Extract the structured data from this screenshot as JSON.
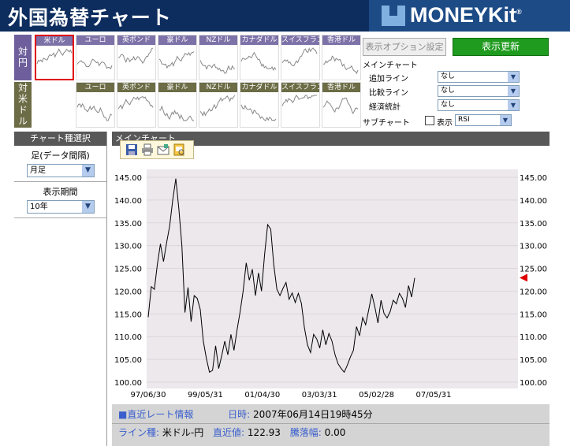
{
  "header": {
    "title": "外国為替チャート",
    "logo_text": "MONEYKit",
    "logo_registered": "®"
  },
  "thumbnails": {
    "row_jpy_label": "対円",
    "row_usd_label": "対米ドル",
    "jpy": [
      "米ドル",
      "ユーロ",
      "英ポンド",
      "豪ドル",
      "NZドル",
      "カナダドル",
      "スイスフラン",
      "香港ドル"
    ],
    "usd": [
      "ユーロ",
      "英ポンド",
      "豪ドル",
      "NZドル",
      "カナダドル",
      "スイスフラン",
      "香港ドル"
    ],
    "selected": "米ドル"
  },
  "options": {
    "settings_button": "表示オプション設定",
    "refresh_button": "表示更新",
    "main_chart_heading": "メインチャート",
    "add_line_label": "追加ライン",
    "add_line_value": "なし",
    "compare_line_label": "比較ライン",
    "compare_line_value": "なし",
    "econ_stats_label": "経済統計",
    "econ_stats_value": "なし",
    "sub_chart_label": "サブチャート",
    "display_label": "表示",
    "sub_chart_value": "RSI"
  },
  "left_panel": {
    "header": "チャート種選択",
    "interval_caption": "足(データ間隔)",
    "interval_value": "月足",
    "period_caption": "表示期間",
    "period_value": "10年"
  },
  "main_chart": {
    "title": "メインチャート",
    "toolbar_icons": [
      "save-icon",
      "print-icon",
      "mail-icon",
      "print-preview-icon"
    ]
  },
  "chart_data": {
    "type": "line",
    "ylim": [
      100,
      145
    ],
    "y_ticks": [
      "145.00",
      "140.00",
      "135.00",
      "130.00",
      "125.00",
      "120.00",
      "115.00",
      "110.00",
      "105.00",
      "100.00"
    ],
    "x_ticks": [
      "97/06/30",
      "99/05/31",
      "01/04/30",
      "03/03/31",
      "05/02/28",
      "07/05/31"
    ],
    "series": [
      {
        "values": [
          114.3,
          121.0,
          120.4,
          126.0,
          130.4,
          126.5,
          130.6,
          134.3,
          140.0,
          144.7,
          138.0,
          130.0,
          115.3,
          120.8,
          113.3,
          119.0,
          118.4,
          116.0,
          109.0,
          105.2,
          102.2,
          102.6,
          108.0,
          103.0,
          105.8,
          109.0,
          106.0,
          110.5,
          107.0,
          111.5,
          115.5,
          120.0,
          126.2,
          122.4,
          124.8,
          119.0,
          124.0,
          120.0,
          128.0,
          134.6,
          133.6,
          125.7,
          120.4,
          119.0,
          120.6,
          121.9,
          118.2,
          119.6,
          117.5,
          119.5,
          117.3,
          112.0,
          108.2,
          106.5,
          110.5,
          109.5,
          107.5,
          111.5,
          108.2,
          110.7,
          109.0,
          106.0,
          104.0,
          103.0,
          102.2,
          103.7,
          105.5,
          107.0,
          112.2,
          110.2,
          114.2,
          112.6,
          115.9,
          119.4,
          116.5,
          113.0,
          118.0,
          115.1,
          114.1,
          115.5,
          118.0,
          117.2,
          119.5,
          118.4,
          116.4,
          121.2,
          118.7,
          122.9
        ]
      }
    ],
    "current_marker_value": 122.93,
    "grid": true
  },
  "info": {
    "section_label": "■直近レート情報",
    "datetime_label": "日時:",
    "datetime_value": "2007年06月14日19時45分",
    "line_type_label": "ライン種:",
    "line_type_value": "米ドル-円",
    "latest_label": "直近値:",
    "latest_value": "122.93",
    "change_label": "騰落幅:",
    "change_value": "0.00"
  }
}
